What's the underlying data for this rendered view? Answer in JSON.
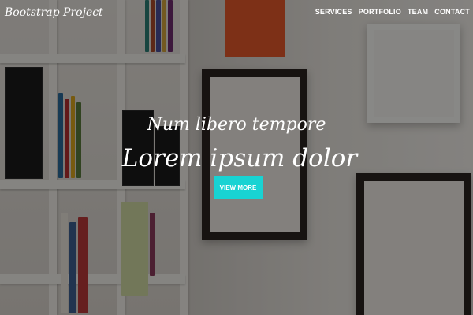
{
  "navbar": {
    "brand": "Bootstrap Project",
    "links": [
      "SERVICES",
      "PORTFOLIO",
      "TEAM",
      "CONTACT"
    ]
  },
  "hero": {
    "subheading": "Num libero tempore",
    "heading": "Lorem ipsum dolor",
    "cta_label": "VIEW MORE",
    "background_image": "office-shelves-wall-frames",
    "accent_color": "#18d3d3"
  }
}
